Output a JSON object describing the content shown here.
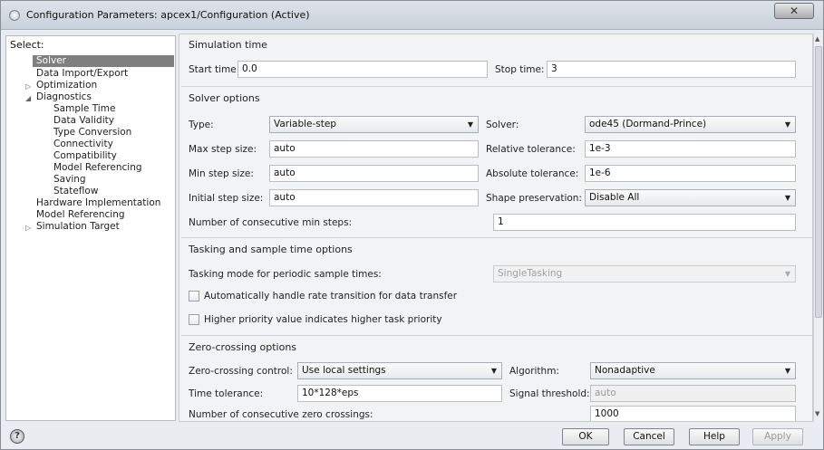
{
  "window": {
    "title": "Configuration Parameters: apcex1/Configuration (Active)",
    "close_label": "✕"
  },
  "tree": {
    "select_label": "Select:",
    "items": [
      {
        "label": "Solver",
        "selected": true
      },
      {
        "label": "Data Import/Export"
      },
      {
        "label": "Optimization",
        "expander": "▷"
      },
      {
        "label": "Diagnostics",
        "expander": "◢"
      },
      {
        "label": "Sample Time"
      },
      {
        "label": "Data Validity"
      },
      {
        "label": "Type Conversion"
      },
      {
        "label": "Connectivity"
      },
      {
        "label": "Compatibility"
      },
      {
        "label": "Model Referencing"
      },
      {
        "label": "Saving"
      },
      {
        "label": "Stateflow"
      },
      {
        "label": "Hardware Implementation"
      },
      {
        "label": "Model Referencing"
      },
      {
        "label": "Simulation Target",
        "expander": "▷"
      }
    ]
  },
  "simulation_time": {
    "title": "Simulation time",
    "start_label": "Start time:",
    "start_value": "0.0",
    "stop_label": "Stop time:",
    "stop_value": "3"
  },
  "solver_options": {
    "title": "Solver options",
    "type_label": "Type:",
    "type_value": "Variable-step",
    "solver_label": "Solver:",
    "solver_value": "ode45 (Dormand-Prince)",
    "max_step_label": "Max step size:",
    "max_step_value": "auto",
    "rel_tol_label": "Relative tolerance:",
    "rel_tol_value": "1e-3",
    "min_step_label": "Min step size:",
    "min_step_value": "auto",
    "abs_tol_label": "Absolute tolerance:",
    "abs_tol_value": "1e-6",
    "init_step_label": "Initial step size:",
    "init_step_value": "auto",
    "shape_label": "Shape preservation:",
    "shape_value": "Disable All",
    "consec_min_label": "Number of consecutive min steps:",
    "consec_min_value": "1"
  },
  "tasking": {
    "title": "Tasking and sample time options",
    "mode_label": "Tasking mode for periodic sample times:",
    "mode_value": "SingleTasking",
    "rate_transition_label": "Automatically handle rate transition for data transfer",
    "rate_transition_checked": false,
    "priority_label": "Higher priority value indicates higher task priority",
    "priority_checked": false
  },
  "zero_crossing": {
    "title": "Zero-crossing options",
    "control_label": "Zero-crossing control:",
    "control_value": "Use local settings",
    "algorithm_label": "Algorithm:",
    "algorithm_value": "Nonadaptive",
    "time_tol_label": "Time tolerance:",
    "time_tol_value": "10*128*eps",
    "signal_threshold_label": "Signal threshold:",
    "signal_threshold_value": "auto",
    "consec_zc_label": "Number of consecutive zero crossings:",
    "consec_zc_value": "1000"
  },
  "footer": {
    "help_icon": "?",
    "ok_label": "OK",
    "cancel_label": "Cancel",
    "help_label": "Help",
    "apply_label": "Apply"
  },
  "icons": {
    "dropdown_caret": "▼",
    "scroll_up": "▲",
    "scroll_down": "▼"
  },
  "colors": {
    "selected_bg": "#7f7f7f",
    "pane_bg": "#f2f3f5",
    "window_bg": "#e9ecf0"
  }
}
